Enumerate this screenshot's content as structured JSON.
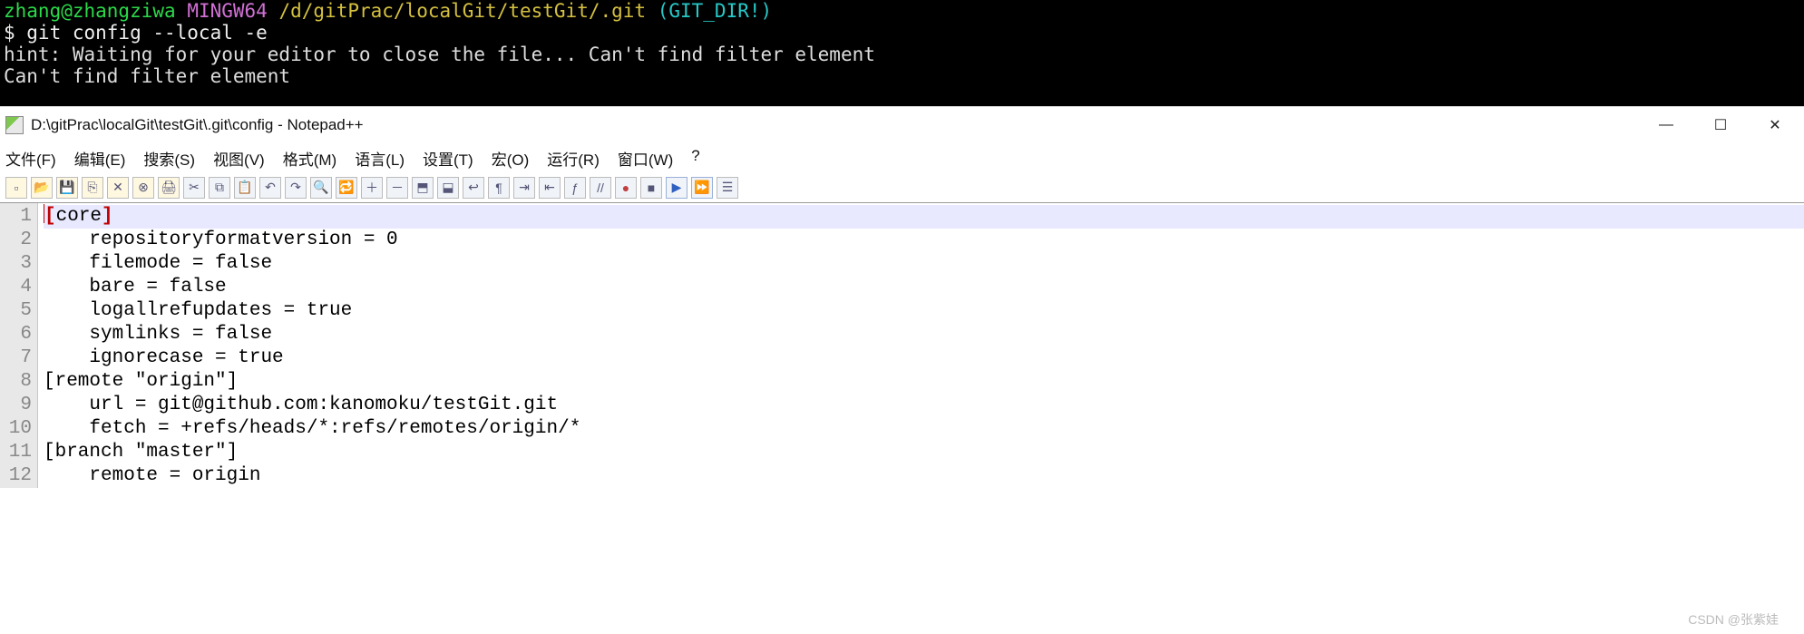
{
  "terminal": {
    "prompt_user": "zhang@zhangziwa",
    "prompt_host": "MINGW64",
    "prompt_path": "/d/gitPrac/localGit/testGit/.git",
    "prompt_branch": "(GIT_DIR!)",
    "command": "$ git config --local -e",
    "hint1": "hint: Waiting for your editor to close the file... Can't find filter element",
    "hint2": "Can't find filter element"
  },
  "window": {
    "title": "D:\\gitPrac\\localGit\\testGit\\.git\\config - Notepad++",
    "min": "—",
    "max": "☐",
    "close": "✕"
  },
  "menu": {
    "file": "文件(F)",
    "edit": "编辑(E)",
    "search": "搜索(S)",
    "view": "视图(V)",
    "format": "格式(M)",
    "lang": "语言(L)",
    "settings": "设置(T)",
    "macro": "宏(O)",
    "run": "运行(R)",
    "window": "窗口(W)",
    "help": "?"
  },
  "toolbar_icons": [
    "new-file-icon",
    "open-icon",
    "save-icon",
    "save-all-icon",
    "close-icon",
    "close-all-icon",
    "print-icon",
    "cut-icon",
    "copy-icon",
    "paste-icon",
    "undo-icon",
    "redo-icon",
    "find-icon",
    "replace-icon",
    "zoom-in-icon",
    "zoom-out-icon",
    "sync-v-icon",
    "sync-h-icon",
    "wrap-icon",
    "show-all-icon",
    "indent-icon",
    "outdent-icon",
    "fx-icon",
    "comment-icon",
    "record-icon",
    "stop-icon",
    "play-icon",
    "playfast-icon",
    "playlist-icon"
  ],
  "editor": {
    "lines": [
      {
        "n": 1,
        "text": "[core]",
        "hl": true,
        "bracket": true
      },
      {
        "n": 2,
        "text": "\trepositoryformatversion = 0"
      },
      {
        "n": 3,
        "text": "\tfilemode = false"
      },
      {
        "n": 4,
        "text": "\tbare = false"
      },
      {
        "n": 5,
        "text": "\tlogallrefupdates = true"
      },
      {
        "n": 6,
        "text": "\tsymlinks = false"
      },
      {
        "n": 7,
        "text": "\tignorecase = true"
      },
      {
        "n": 8,
        "text": "[remote \"origin\"]"
      },
      {
        "n": 9,
        "text": "\turl = git@github.com:kanomoku/testGit.git"
      },
      {
        "n": 10,
        "text": "\tfetch = +refs/heads/*:refs/remotes/origin/*"
      },
      {
        "n": 11,
        "text": "[branch \"master\"]"
      },
      {
        "n": 12,
        "text": "\tremote = origin"
      }
    ]
  },
  "watermark": "CSDN @张紫娃"
}
